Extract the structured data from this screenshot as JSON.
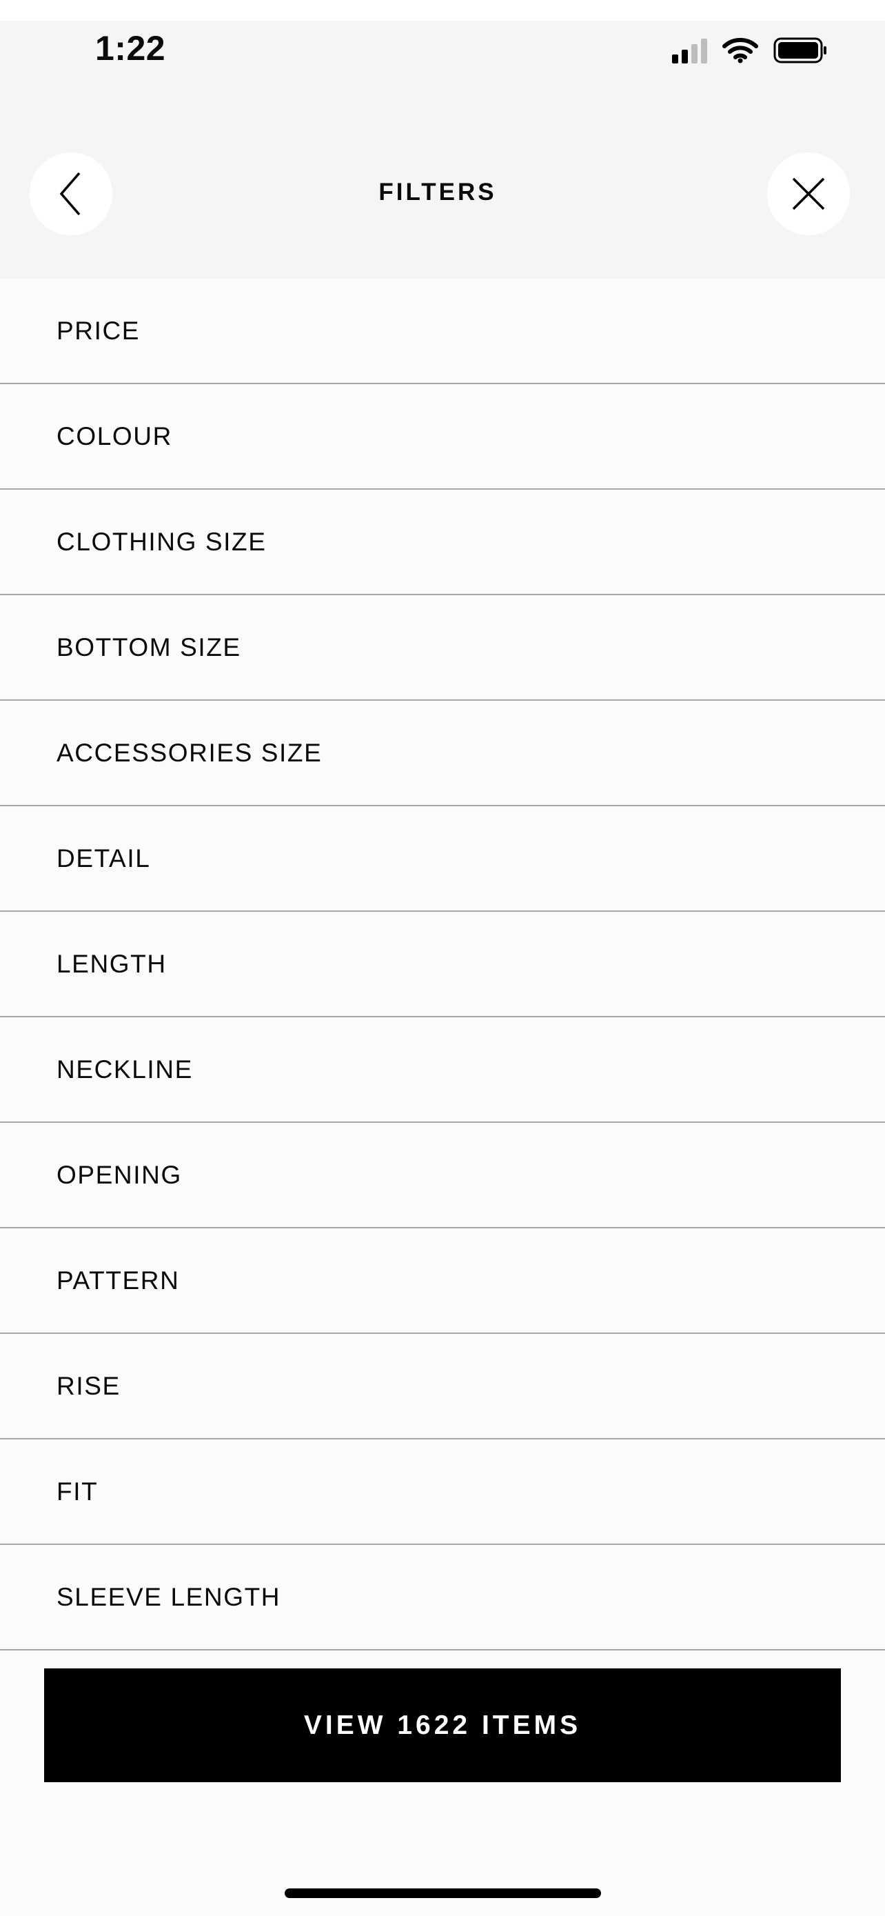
{
  "status_bar": {
    "time": "1:22",
    "icons": [
      "cellular-signal-icon",
      "wifi-icon",
      "battery-icon"
    ]
  },
  "header": {
    "title": "FILTERS",
    "back_icon": "chevron-left-icon",
    "close_icon": "close-icon"
  },
  "filters": [
    {
      "label": "PRICE"
    },
    {
      "label": "COLOUR"
    },
    {
      "label": "CLOTHING SIZE"
    },
    {
      "label": "BOTTOM SIZE"
    },
    {
      "label": "ACCESSORIES SIZE"
    },
    {
      "label": "DETAIL"
    },
    {
      "label": "LENGTH"
    },
    {
      "label": "NECKLINE"
    },
    {
      "label": "OPENING"
    },
    {
      "label": "PATTERN"
    },
    {
      "label": "RISE"
    },
    {
      "label": "FIT"
    },
    {
      "label": "SLEEVE LENGTH"
    }
  ],
  "footer": {
    "view_button_label": "VIEW 1622 ITEMS"
  },
  "colors": {
    "header_bg": "#f5f5f5",
    "page_bg": "#fbfbfb",
    "divider": "#a8a8a8",
    "button_bg": "#000000",
    "button_text": "#ffffff"
  }
}
